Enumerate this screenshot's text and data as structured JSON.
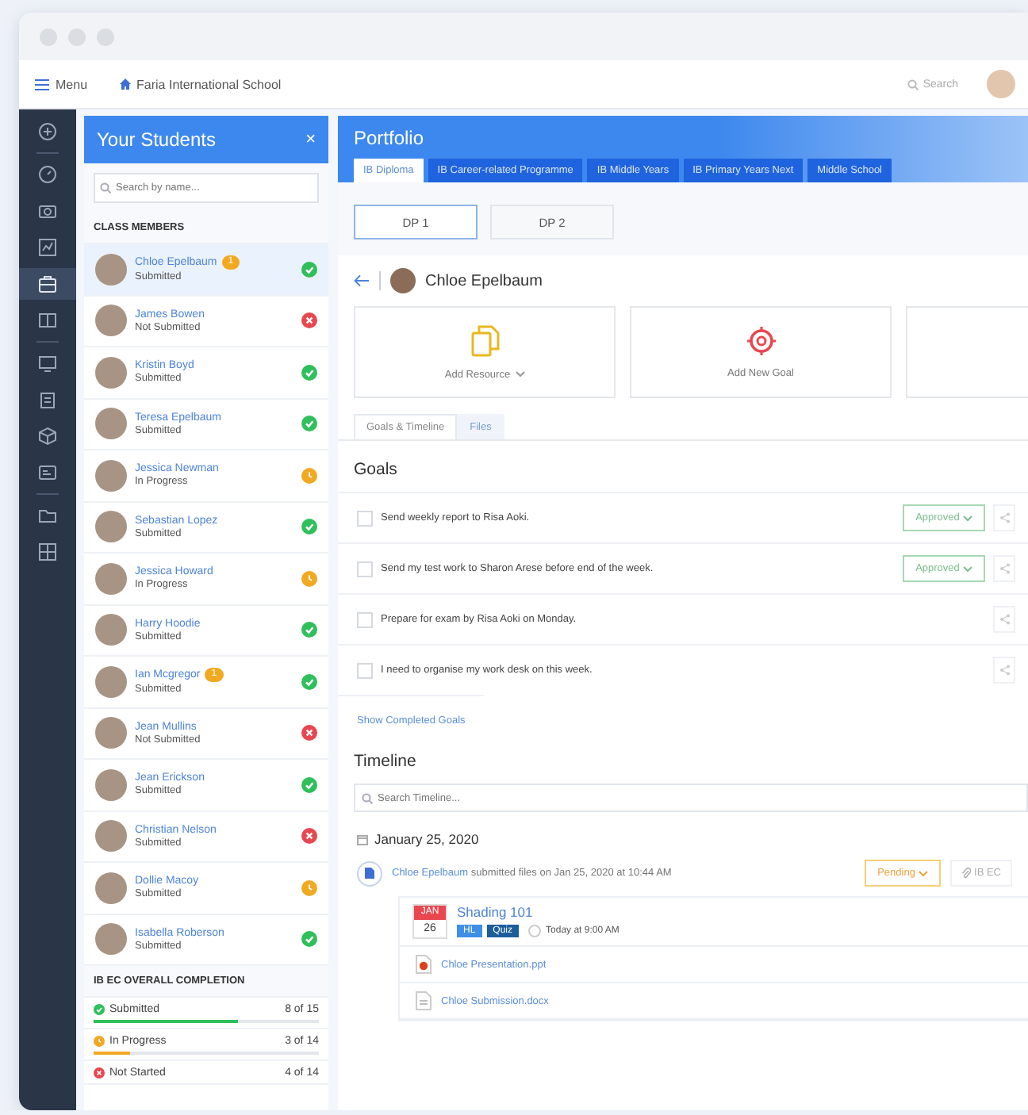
{
  "top_bar": {
    "menu_label": "Menu",
    "school": "Faria International School",
    "search_placeholder": "Search"
  },
  "rail": [
    {
      "selected": false
    },
    {
      "selected": false
    },
    {
      "selected": false
    },
    {
      "selected": false
    },
    {
      "selected": true
    },
    {
      "selected": false
    },
    {
      "selected": false
    },
    {
      "selected": false
    },
    {
      "selected": false
    },
    {
      "selected": false
    },
    {
      "selected": false
    },
    {
      "selected": false
    }
  ],
  "students": {
    "title": "Your Students",
    "close": "×",
    "search_placeholder": "Search by name...",
    "section": "CLASS MEMBERS",
    "items": [
      {
        "name": "Chloe Epelbaum",
        "status": "Submitted",
        "badge": "1",
        "kind": "check",
        "selected": true
      },
      {
        "name": "James Bowen",
        "status": "Not Submitted",
        "kind": "cross",
        "selected": false
      },
      {
        "name": "Kristin Boyd",
        "status": "Submitted",
        "kind": "check",
        "selected": false
      },
      {
        "name": "Teresa Epelbaum",
        "status": "Submitted",
        "kind": "check",
        "selected": false
      },
      {
        "name": "Jessica Newman",
        "status": "In Progress",
        "kind": "clock",
        "selected": false
      },
      {
        "name": "Sebastian Lopez",
        "status": "Submitted",
        "kind": "check",
        "selected": false
      },
      {
        "name": "Jessica Howard",
        "status": "In Progress",
        "kind": "clock",
        "selected": false
      },
      {
        "name": "Harry Hoodie",
        "status": "Submitted",
        "kind": "check",
        "selected": false
      },
      {
        "name": "Ian Mcgregor",
        "status": "Submitted",
        "badge": "1",
        "kind": "check",
        "selected": false
      },
      {
        "name": "Jean Mullins",
        "status": "Not Submitted",
        "kind": "cross",
        "selected": false
      },
      {
        "name": "Jean Erickson",
        "status": "Submitted",
        "kind": "check",
        "selected": false
      },
      {
        "name": "Christian Nelson",
        "status": "Submitted",
        "kind": "cross",
        "selected": false
      },
      {
        "name": "Dollie Macoy",
        "status": "Submitted",
        "kind": "clock",
        "selected": false
      },
      {
        "name": "Isabella Roberson",
        "status": "Submitted",
        "kind": "check",
        "selected": false
      }
    ],
    "completion_title": "IB EC OVERALL COMPLETION",
    "completion": [
      {
        "label": "Submitted",
        "count": "8 of 15",
        "kind": "check",
        "level": 0.64
      },
      {
        "label": "In Progress",
        "count": "3 of 14",
        "kind": "clock",
        "level": 0.16
      },
      {
        "label": "Not Started",
        "count": "4 of 14",
        "kind": "cross"
      }
    ]
  },
  "portfolio": {
    "title": "Portfolio",
    "programme_tabs": [
      {
        "label": "IB Diploma",
        "selected": true
      },
      {
        "label": "IB Career-related Programme",
        "selected": false
      },
      {
        "label": "IB Middle Years",
        "selected": false
      },
      {
        "label": "IB Primary Years Next",
        "selected": false
      },
      {
        "label": "Middle School",
        "selected": false
      }
    ],
    "year_tabs": [
      {
        "label": "DP 1",
        "selected": true
      },
      {
        "label": "DP 2",
        "selected": false
      }
    ],
    "student": "Chloe Epelbaum",
    "actions": [
      {
        "label": "Add Resource",
        "kind": "resource"
      },
      {
        "label": "Add New Goal",
        "kind": "goal"
      },
      {
        "kind": "cut"
      }
    ],
    "view_tabs": [
      {
        "label": "Goals & Timeline",
        "selected": true
      },
      {
        "label": "Files",
        "selected": false
      }
    ],
    "goals_title": "Goals",
    "goals": [
      {
        "text": "Send weekly report to Risa Aoki.",
        "checked": false,
        "status": "Approved"
      },
      {
        "text": "Send my test work to Sharon Arese before end of the week.",
        "checked": false,
        "status": "Approved"
      },
      {
        "text": "Prepare for exam by Risa Aoki on Monday.",
        "checked": false
      },
      {
        "text": "I need to organise my work desk on this week.",
        "checked": false
      }
    ],
    "show_completed": "Show Completed Goals",
    "timeline_title": "Timeline",
    "timeline_search_placeholder": "Search Timeline...",
    "date": "January 25, 2020",
    "entry": {
      "actor": "Chloe Epelbaum",
      "text": " submitted files on Jan 25, 2020 at 10:44 AM",
      "status": "Pending",
      "link": "IB EC",
      "task": {
        "month": "JAN",
        "day": "26",
        "title": "Shading 101",
        "tags": [
          {
            "label": "HL",
            "color": "#3d8fe8"
          },
          {
            "label": "Quiz",
            "color": "#1d5d9c"
          }
        ],
        "time": "Today at 9:00 AM"
      },
      "files": [
        {
          "name": "Chloe Presentation.ppt",
          "kind": "ppt"
        },
        {
          "name": "Chloe Submission.docx",
          "kind": "doc"
        }
      ]
    }
  }
}
